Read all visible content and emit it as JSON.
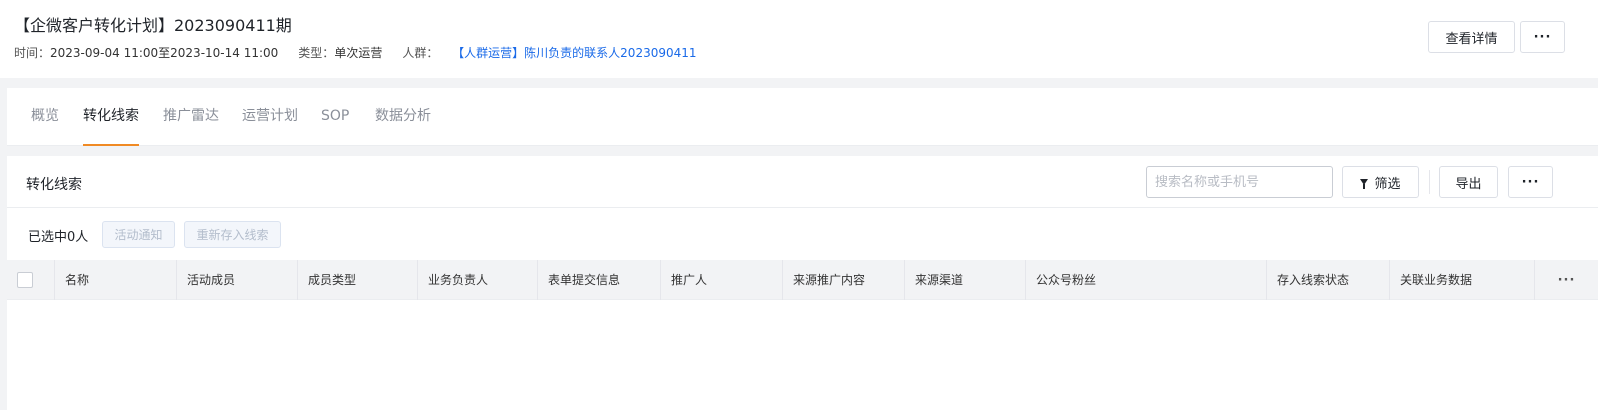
{
  "header": {
    "title": "【企微客户转化计划】2023090411期",
    "time_label": "时间：",
    "time_value": "2023-09-04 11:00至2023-10-14 11:00",
    "type_label": "类型：",
    "type_value": "单次运营",
    "crowd_label": "人群：",
    "crowd_value": "【人群运营】陈川负责的联系人2023090411",
    "detail_button": "查看详情",
    "more_button": "···"
  },
  "tabs": [
    {
      "label": "概览"
    },
    {
      "label": "转化线索",
      "active": true
    },
    {
      "label": "推广雷达"
    },
    {
      "label": "运营计划"
    },
    {
      "label": "SOP"
    },
    {
      "label": "数据分析"
    }
  ],
  "panel": {
    "title": "转化线索",
    "search_placeholder": "搜索名称或手机号",
    "filter_button": "筛选",
    "export_button": "导出",
    "more_button": "···",
    "selected_text": "已选中0人",
    "notify_button": "活动通知",
    "restore_button": "重新存入线索"
  },
  "table": {
    "columns": [
      "名称",
      "活动成员",
      "成员类型",
      "业务负责人",
      "表单提交信息",
      "推广人",
      "来源推广内容",
      "来源渠道",
      "公众号粉丝",
      "存入线索状态",
      "关联业务数据"
    ],
    "more": "···",
    "rows": []
  },
  "colors": {
    "accent": "#f08a24",
    "link": "#1a6ae8",
    "header_bg": "#f2f3f5"
  }
}
